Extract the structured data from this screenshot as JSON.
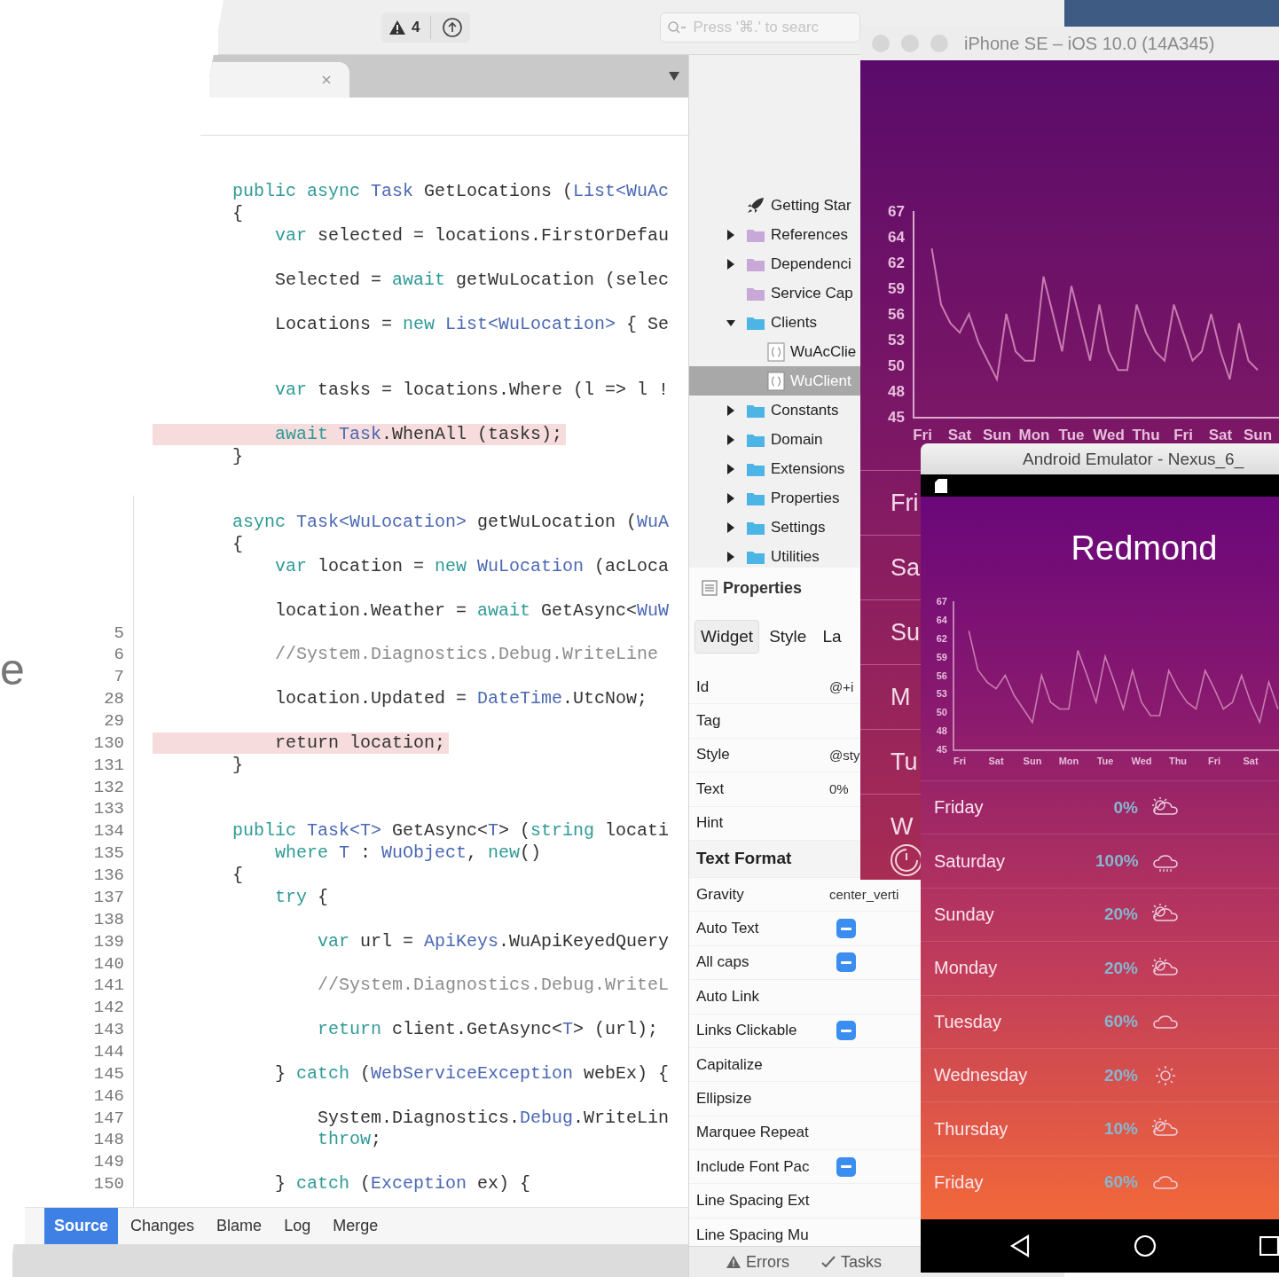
{
  "page_text": "e",
  "ide": {
    "toolbar": {
      "issue_count": "4",
      "search": {
        "placeholder": "Press '⌘.' to searc"
      }
    },
    "editor": {
      "lines": [
        {
          "kind": "code",
          "highlighted": false,
          "tokens": [
            {
              "text": "public async ",
              "kind": "keyword"
            },
            {
              "text": "Task",
              "kind": "type"
            },
            {
              "text": " GetLocations (",
              "kind": "plain"
            },
            {
              "text": "List<WuAc",
              "kind": "type"
            }
          ]
        },
        {
          "kind": "code",
          "highlighted": false,
          "tokens": [
            {
              "text": "{",
              "kind": "plain"
            }
          ]
        },
        {
          "kind": "code",
          "highlighted": false,
          "tokens": [
            {
              "text": "    var",
              "kind": "keyword"
            },
            {
              "text": " selected = locations.FirstOrDefau",
              "kind": "plain"
            }
          ]
        },
        {
          "kind": "blank"
        },
        {
          "kind": "code",
          "highlighted": false,
          "tokens": [
            {
              "text": "    Selected = ",
              "kind": "plain"
            },
            {
              "text": "await",
              "kind": "keyword"
            },
            {
              "text": " getWuLocation (selec",
              "kind": "plain"
            }
          ]
        },
        {
          "kind": "blank"
        },
        {
          "kind": "code",
          "highlighted": false,
          "tokens": [
            {
              "text": "    Locations = ",
              "kind": "plain"
            },
            {
              "text": "new ",
              "kind": "keyword"
            },
            {
              "text": "List<WuLocation>",
              "kind": "type"
            },
            {
              "text": " { Se",
              "kind": "plain"
            }
          ]
        },
        {
          "kind": "blank"
        },
        {
          "kind": "blank"
        },
        {
          "kind": "code",
          "highlighted": false,
          "tokens": [
            {
              "text": "    var",
              "kind": "keyword"
            },
            {
              "text": " tasks = locations.Where (l => l !",
              "kind": "plain"
            }
          ]
        },
        {
          "kind": "blank"
        },
        {
          "kind": "code",
          "highlighted": true,
          "tokens": [
            {
              "text": "    await ",
              "kind": "keyword"
            },
            {
              "text": "Task",
              "kind": "type"
            },
            {
              "text": ".WhenAll (tasks);",
              "kind": "plain"
            }
          ]
        },
        {
          "kind": "code",
          "highlighted": false,
          "tokens": [
            {
              "text": "}",
              "kind": "plain"
            }
          ]
        },
        {
          "kind": "blank"
        },
        {
          "kind": "blank"
        },
        {
          "kind": "code",
          "highlighted": false,
          "tokens": [
            {
              "text": "async ",
              "kind": "keyword"
            },
            {
              "text": "Task<WuLocation>",
              "kind": "type"
            },
            {
              "text": " getWuLocation (",
              "kind": "plain"
            },
            {
              "text": "WuA",
              "kind": "type"
            }
          ]
        },
        {
          "kind": "code",
          "highlighted": false,
          "tokens": [
            {
              "text": "{",
              "kind": "plain"
            }
          ]
        },
        {
          "kind": "code",
          "highlighted": false,
          "tokens": [
            {
              "text": "    var",
              "kind": "keyword"
            },
            {
              "text": " location = ",
              "kind": "plain"
            },
            {
              "text": "new ",
              "kind": "keyword"
            },
            {
              "text": "WuLocation",
              "kind": "type"
            },
            {
              "text": " (acLoca",
              "kind": "plain"
            }
          ]
        },
        {
          "kind": "blank"
        },
        {
          "kind": "code",
          "highlighted": false,
          "tokens": [
            {
              "text": "    location.Weather = ",
              "kind": "plain"
            },
            {
              "text": "await",
              "kind": "keyword"
            },
            {
              "text": " GetAsync<",
              "kind": "plain"
            },
            {
              "text": "WuW",
              "kind": "type"
            }
          ]
        },
        {
          "kind": "blank",
          "num": "5"
        },
        {
          "kind": "code",
          "num": "6",
          "highlighted": false,
          "tokens": [
            {
              "text": "    //System.Diagnostics.Debug.WriteLine",
              "kind": "comment"
            }
          ]
        },
        {
          "kind": "blank",
          "num": "7"
        },
        {
          "kind": "code",
          "num": "28",
          "highlighted": false,
          "tokens": [
            {
              "text": "    location.Updated = ",
              "kind": "plain"
            },
            {
              "text": "DateTime",
              "kind": "type"
            },
            {
              "text": ".UtcNow;",
              "kind": "plain"
            }
          ]
        },
        {
          "kind": "blank",
          "num": "29"
        },
        {
          "kind": "code",
          "num": "130",
          "highlighted": true,
          "tokens": [
            {
              "text": "    return location;",
              "kind": "plain"
            }
          ]
        },
        {
          "kind": "code",
          "num": "131",
          "highlighted": false,
          "tokens": [
            {
              "text": "}",
              "kind": "plain"
            }
          ]
        },
        {
          "kind": "blank",
          "num": "132"
        },
        {
          "kind": "blank",
          "num": "133"
        },
        {
          "kind": "code",
          "num": "134",
          "highlighted": false,
          "tokens": [
            {
              "text": "public ",
              "kind": "keyword"
            },
            {
              "text": "Task<T>",
              "kind": "type"
            },
            {
              "text": " GetAsync<",
              "kind": "plain"
            },
            {
              "text": "T",
              "kind": "type"
            },
            {
              "text": "> (",
              "kind": "plain"
            },
            {
              "text": "string",
              "kind": "keyword"
            },
            {
              "text": " locati",
              "kind": "plain"
            }
          ]
        },
        {
          "kind": "code",
          "num": "135",
          "highlighted": false,
          "tokens": [
            {
              "text": "    where ",
              "kind": "keyword"
            },
            {
              "text": "T",
              "kind": "type"
            },
            {
              "text": " : ",
              "kind": "plain"
            },
            {
              "text": "WuObject",
              "kind": "type"
            },
            {
              "text": ", ",
              "kind": "plain"
            },
            {
              "text": "new",
              "kind": "keyword"
            },
            {
              "text": "()",
              "kind": "plain"
            }
          ]
        },
        {
          "kind": "code",
          "num": "136",
          "highlighted": false,
          "tokens": [
            {
              "text": "{",
              "kind": "plain"
            }
          ]
        },
        {
          "kind": "code",
          "num": "137",
          "highlighted": false,
          "tokens": [
            {
              "text": "    try",
              "kind": "keyword"
            },
            {
              "text": " {",
              "kind": "plain"
            }
          ]
        },
        {
          "kind": "blank",
          "num": "138"
        },
        {
          "kind": "code",
          "num": "139",
          "highlighted": false,
          "tokens": [
            {
              "text": "        var",
              "kind": "keyword"
            },
            {
              "text": " url = ",
              "kind": "plain"
            },
            {
              "text": "ApiKeys",
              "kind": "type"
            },
            {
              "text": ".WuApiKeyedQuery",
              "kind": "plain"
            }
          ]
        },
        {
          "kind": "blank",
          "num": "140"
        },
        {
          "kind": "code",
          "num": "141",
          "highlighted": false,
          "tokens": [
            {
              "text": "        //System.Diagnostics.Debug.WriteL",
              "kind": "comment"
            }
          ]
        },
        {
          "kind": "blank",
          "num": "142"
        },
        {
          "kind": "code",
          "num": "143",
          "highlighted": false,
          "tokens": [
            {
              "text": "        return",
              "kind": "keyword"
            },
            {
              "text": " client.GetAsync<",
              "kind": "plain"
            },
            {
              "text": "T",
              "kind": "type"
            },
            {
              "text": "> (url);",
              "kind": "plain"
            }
          ]
        },
        {
          "kind": "blank",
          "num": "144"
        },
        {
          "kind": "code",
          "num": "145",
          "highlighted": false,
          "tokens": [
            {
              "text": "    } ",
              "kind": "plain"
            },
            {
              "text": "catch",
              "kind": "keyword"
            },
            {
              "text": " (",
              "kind": "plain"
            },
            {
              "text": "WebServiceException",
              "kind": "type"
            },
            {
              "text": " webEx) {",
              "kind": "plain"
            }
          ]
        },
        {
          "kind": "blank",
          "num": "146"
        },
        {
          "kind": "code",
          "num": "147",
          "highlighted": false,
          "tokens": [
            {
              "text": "        System.Diagnostics.",
              "kind": "plain"
            },
            {
              "text": "Debug",
              "kind": "type"
            },
            {
              "text": ".WriteLin",
              "kind": "plain"
            }
          ]
        },
        {
          "kind": "code",
          "num": "148",
          "highlighted": false,
          "tokens": [
            {
              "text": "        throw",
              "kind": "keyword"
            },
            {
              "text": ";",
              "kind": "plain"
            }
          ]
        },
        {
          "kind": "blank",
          "num": "149"
        },
        {
          "kind": "code",
          "num": "150",
          "highlighted": false,
          "tokens": [
            {
              "text": "    } ",
              "kind": "plain"
            },
            {
              "text": "catch",
              "kind": "keyword"
            },
            {
              "text": " (",
              "kind": "plain"
            },
            {
              "text": "Exception",
              "kind": "type"
            },
            {
              "text": " ex) {",
              "kind": "plain"
            }
          ]
        }
      ]
    },
    "bottom_tabs": [
      {
        "label": "Source",
        "selected": true
      },
      {
        "label": "Changes",
        "selected": false
      },
      {
        "label": "Blame",
        "selected": false
      },
      {
        "label": "Log",
        "selected": false
      },
      {
        "label": "Merge",
        "selected": false
      }
    ],
    "solution": {
      "items": [
        {
          "label": "Getting Star",
          "kind": "rocket",
          "selected": false
        },
        {
          "label": "References",
          "kind": "reference-folder",
          "expanded": false,
          "selected": false
        },
        {
          "label": "Dependenci",
          "kind": "reference-folder",
          "expanded": false,
          "selected": false
        },
        {
          "label": "Service Cap",
          "kind": "reference-folder",
          "selected": false
        },
        {
          "label": "Clients",
          "kind": "folder",
          "expanded": true,
          "selected": false,
          "children": [
            {
              "label": "WuAcClie",
              "kind": "file",
              "selected": false
            },
            {
              "label": "WuClient",
              "kind": "file",
              "selected": true
            }
          ]
        },
        {
          "label": "Constants",
          "kind": "folder",
          "expanded": false,
          "selected": false
        },
        {
          "label": "Domain",
          "kind": "folder",
          "expanded": false,
          "selected": false
        },
        {
          "label": "Extensions",
          "kind": "folder",
          "expanded": false,
          "selected": false
        },
        {
          "label": "Properties",
          "kind": "folder",
          "expanded": false,
          "selected": false
        },
        {
          "label": "Settings",
          "kind": "folder",
          "expanded": false,
          "selected": false
        },
        {
          "label": "Utilities",
          "kind": "folder",
          "expanded": false,
          "selected": false
        }
      ]
    },
    "properties": {
      "title": "Properties",
      "tabs": [
        {
          "label": "Widget",
          "selected": true
        },
        {
          "label": "Style",
          "selected": false
        },
        {
          "label": "La",
          "selected": false
        }
      ],
      "rows": [
        {
          "kind": "field",
          "label": "Id",
          "value": "@+i"
        },
        {
          "kind": "field",
          "label": "Tag"
        },
        {
          "kind": "field",
          "label": "Style",
          "value": "@sty"
        },
        {
          "kind": "field",
          "label": "Text",
          "value": "0%"
        },
        {
          "kind": "field",
          "label": "Hint"
        },
        {
          "kind": "section",
          "label": "Text Format"
        },
        {
          "kind": "field",
          "label": "Gravity",
          "value": "center_verti"
        },
        {
          "kind": "check",
          "label": "Auto Text",
          "mixed": true
        },
        {
          "kind": "check",
          "label": "All caps",
          "mixed": true
        },
        {
          "kind": "check",
          "label": "Auto Link",
          "mixed": false
        },
        {
          "kind": "check",
          "label": "Links Clickable",
          "mixed": true
        },
        {
          "kind": "check",
          "label": "Capitalize",
          "mixed": false
        },
        {
          "kind": "check",
          "label": "Ellipsize",
          "mixed": false
        },
        {
          "kind": "check",
          "label": "Marquee Repeat",
          "mixed": false
        },
        {
          "kind": "check",
          "label": "Include Font Pac",
          "mixed": true
        },
        {
          "kind": "check",
          "label": "Line Spacing Ext",
          "mixed": false
        },
        {
          "kind": "check",
          "label": "Line Spacing Mu",
          "mixed": false
        }
      ]
    },
    "status_bar": [
      {
        "label": "Errors",
        "kind": "errors"
      },
      {
        "label": "Tasks",
        "kind": "tasks"
      }
    ]
  },
  "iphone": {
    "title": "iPhone SE – iOS 10.0 (14A345)",
    "chart_data": {
      "type": "line",
      "ylim": [
        45,
        67
      ],
      "categories": [
        "Fri",
        null,
        null,
        null,
        "Sat",
        null,
        null,
        null,
        "Sun",
        null,
        null,
        null,
        "Mon",
        null,
        null,
        null,
        "Tue",
        null,
        null,
        null,
        "Wed",
        null,
        null,
        null,
        "Thu",
        null,
        null,
        null,
        "Fri",
        null,
        null,
        null,
        "Sat",
        null,
        null,
        null,
        "Sun"
      ],
      "values": [
        null,
        63,
        57,
        55,
        54,
        56,
        53,
        51,
        49,
        56,
        52,
        51,
        51,
        60,
        56,
        52,
        59,
        55,
        51,
        57,
        52,
        50,
        50,
        57,
        54,
        52,
        51,
        57,
        54,
        51,
        52,
        56,
        52,
        49,
        55,
        51,
        50
      ],
      "yticks": [
        {
          "value": 67,
          "label": "67"
        },
        {
          "value": 64.25,
          "label": "64"
        },
        {
          "value": 61.5,
          "label": "62"
        },
        {
          "value": 58.75,
          "label": "59"
        },
        {
          "value": 56,
          "label": "56"
        },
        {
          "value": 53.25,
          "label": "53"
        },
        {
          "value": 50.5,
          "label": "50"
        },
        {
          "value": 47.75,
          "label": "48"
        },
        {
          "value": 45,
          "label": "45"
        }
      ]
    },
    "days": [
      "Fri",
      "Sa",
      "Su",
      "M",
      "Tu",
      "W"
    ]
  },
  "android": {
    "title": "Android Emulator - Nexus_6_",
    "city": "Redmond",
    "chart_data": {
      "type": "line",
      "ylim": [
        45,
        67
      ],
      "categories": [
        "Fri",
        null,
        null,
        null,
        "Sat",
        null,
        null,
        null,
        "Sun",
        null,
        null,
        null,
        "Mon",
        null,
        null,
        null,
        "Tue",
        null,
        null,
        null,
        "Wed",
        null,
        null,
        null,
        "Thu",
        null,
        null,
        null,
        "Fri",
        null,
        null,
        null,
        "Sat",
        null,
        null,
        null
      ],
      "values": [
        null,
        62.6,
        56.8,
        55,
        54,
        56,
        53,
        51,
        49,
        56,
        52,
        51,
        51,
        59.7,
        56,
        52,
        58.8,
        55,
        51,
        56.7,
        52,
        50,
        50,
        56.7,
        54,
        52,
        51,
        56.7,
        54,
        51,
        52,
        56,
        52,
        49,
        55,
        51
      ],
      "yticks": [
        {
          "value": 67,
          "label": "67"
        },
        {
          "value": 64.25,
          "label": "64"
        },
        {
          "value": 61.5,
          "label": "62"
        },
        {
          "value": 58.75,
          "label": "59"
        },
        {
          "value": 56,
          "label": "56"
        },
        {
          "value": 53.25,
          "label": "53"
        },
        {
          "value": 50.5,
          "label": "50"
        },
        {
          "value": 47.75,
          "label": "48"
        },
        {
          "value": 45,
          "label": "45"
        }
      ]
    },
    "forecast": [
      {
        "day": "Friday",
        "chance": "0%",
        "kind": "sun-cloud"
      },
      {
        "day": "Saturday",
        "chance": "100%",
        "kind": "rain"
      },
      {
        "day": "Sunday",
        "chance": "20%",
        "kind": "sun-cloud"
      },
      {
        "day": "Monday",
        "chance": "20%",
        "kind": "sun-cloud"
      },
      {
        "day": "Tuesday",
        "chance": "60%",
        "kind": "cloud"
      },
      {
        "day": "Wednesday",
        "chance": "20%",
        "kind": "sun"
      },
      {
        "day": "Thursday",
        "chance": "10%",
        "kind": "sun-cloud"
      },
      {
        "day": "Friday",
        "chance": "60%",
        "kind": "cloud"
      }
    ]
  }
}
